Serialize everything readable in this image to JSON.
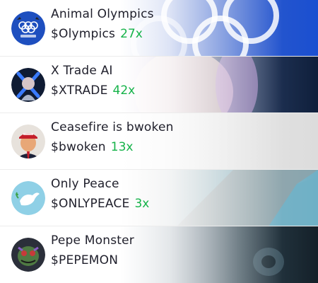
{
  "tokens": [
    {
      "name": "Animal Olympics",
      "ticker": "$Olympics",
      "multiplier": "27x",
      "icon": "olympic-rings-icon"
    },
    {
      "name": "X Trade AI",
      "ticker": "$XTRADE",
      "multiplier": "42x",
      "icon": "x-logo-avatar"
    },
    {
      "name": "Ceasefire is bwoken",
      "ticker": "$bwoken",
      "multiplier": "13x",
      "icon": "person-cap-avatar"
    },
    {
      "name": "Only Peace",
      "ticker": "$ONLYPEACE",
      "multiplier": "3x",
      "icon": "dove-icon"
    },
    {
      "name": "Pepe Monster",
      "ticker": "$PEPEMON",
      "multiplier": "",
      "icon": "monster-avatar"
    }
  ],
  "colors": {
    "multiplier": "#16b34a",
    "text": "#1f1f2b"
  }
}
